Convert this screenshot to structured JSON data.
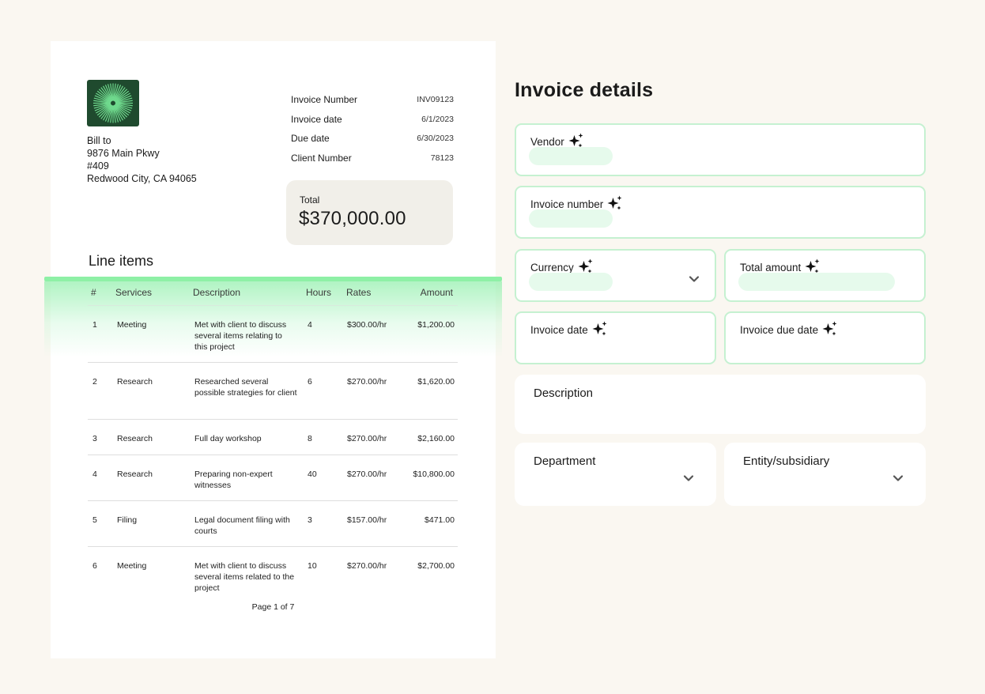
{
  "invoice": {
    "bill_to": [
      "Bill to",
      "9876 Main Pkwy",
      "#409",
      "Redwood City, CA 94065"
    ],
    "meta": [
      {
        "label": "Invoice Number",
        "value": "INV09123"
      },
      {
        "label": "Invoice date",
        "value": "6/1/2023"
      },
      {
        "label": "Due date",
        "value": "6/30/2023"
      },
      {
        "label": "Client Number",
        "value": "78123"
      }
    ],
    "total_label": "Total",
    "total_value": "$370,000.00",
    "line_items_title": "Line items",
    "columns": [
      "#",
      "Services",
      "Description",
      "Hours",
      "Rates",
      "Amount"
    ],
    "rows": [
      {
        "num": "1",
        "service": "Meeting",
        "description": "Met with client to discuss several items relating to this project",
        "hours": "4",
        "rate": "$300.00/hr",
        "amount": "$1,200.00"
      },
      {
        "num": "2",
        "service": "Research",
        "description": "Researched several possible strategies for client",
        "hours": "6",
        "rate": "$270.00/hr",
        "amount": "$1,620.00"
      },
      {
        "num": "3",
        "service": "Research",
        "description": "Full day workshop",
        "hours": "8",
        "rate": "$270.00/hr",
        "amount": "$2,160.00"
      },
      {
        "num": "4",
        "service": "Research",
        "description": "Preparing non-expert witnesses",
        "hours": "40",
        "rate": "$270.00/hr",
        "amount": "$10,800.00"
      },
      {
        "num": "5",
        "service": "Filing",
        "description": "Legal document filing with courts",
        "hours": "3",
        "rate": "$157.00/hr",
        "amount": "$471.00"
      },
      {
        "num": "6",
        "service": "Meeting",
        "description": "Met with client to discuss several items related to the project",
        "hours": "10",
        "rate": "$270.00/hr",
        "amount": "$2,700.00"
      }
    ],
    "page_indicator": "Page 1 of 7"
  },
  "form": {
    "title": "Invoice details",
    "vendor_label": "Vendor",
    "invoice_number_label": "Invoice number",
    "currency_label": "Currency",
    "total_amount_label": "Total amount",
    "invoice_date_label": "Invoice date",
    "invoice_due_date_label": "Invoice due date",
    "description_label": "Description",
    "department_label": "Department",
    "entity_label": "Entity/subsidiary"
  },
  "icons": {
    "logo": "starburst-logo",
    "ai_fill": "sparkle-icon",
    "dropdown": "chevron-down-icon"
  },
  "colors": {
    "background": "#faf7f1",
    "logo_bg": "#1f4a2e",
    "logo_rays": "#6fd98d",
    "accent_green": "#8ef0a6",
    "field_border": "#c5f1d1",
    "placeholder_fill": "#e6faec",
    "total_card": "#f1efe9"
  }
}
